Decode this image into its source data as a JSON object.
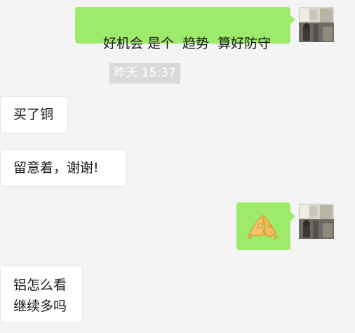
{
  "messages": [
    {
      "direction": "outgoing",
      "type": "text",
      "text": "好机会 是个  趋势  算好防守"
    },
    {
      "type": "timestamp",
      "text": "昨天 15:37"
    },
    {
      "direction": "incoming",
      "type": "text",
      "text": "买了铜"
    },
    {
      "direction": "incoming",
      "type": "text",
      "text": "留意着，谢谢!"
    },
    {
      "direction": "outgoing",
      "type": "emoji",
      "emoji": "folded-hands-icon"
    },
    {
      "direction": "incoming",
      "type": "text",
      "lines": [
        "铝怎么看",
        "继续多吗"
      ]
    }
  ],
  "colors": {
    "background": "#f4f4f4",
    "outgoing_bubble": "#9eea6a",
    "incoming_bubble": "#ffffff",
    "timestamp_bg": "#dadada"
  }
}
